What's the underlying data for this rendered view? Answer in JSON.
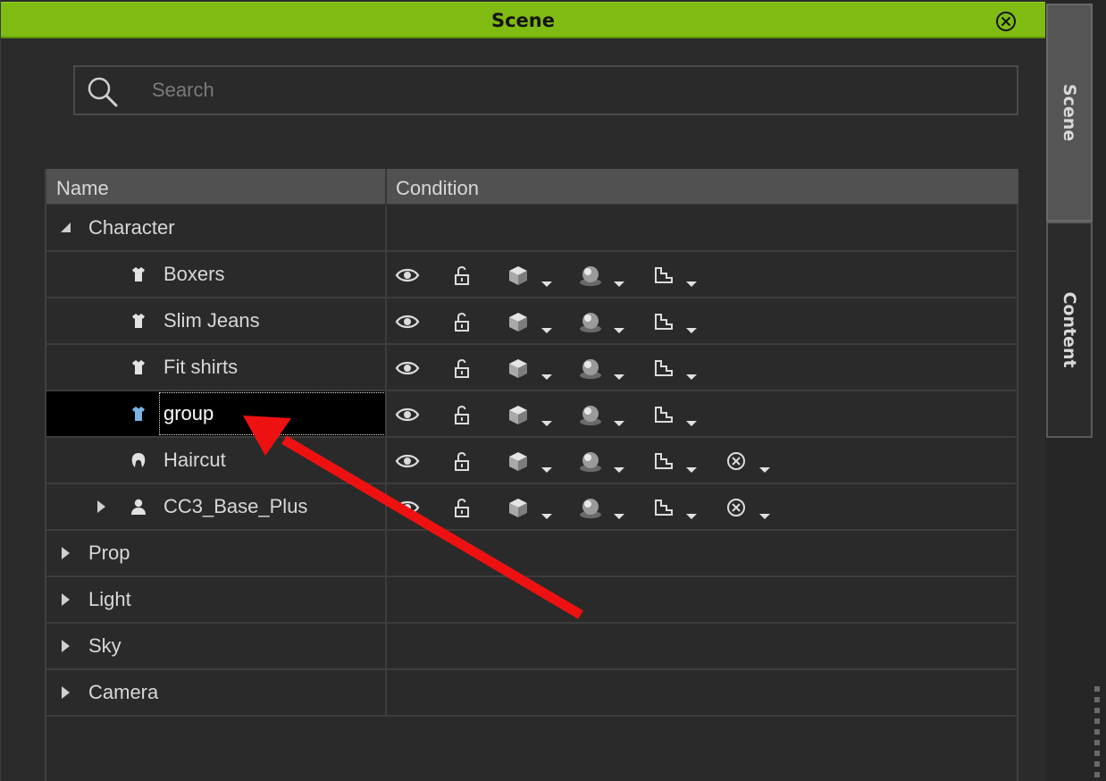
{
  "panel": {
    "title": "Scene",
    "close_icon": "close-circle-icon",
    "accent": "#7fbb12"
  },
  "search": {
    "placeholder": "Search",
    "value": "",
    "icon": "search-icon"
  },
  "table": {
    "columns": [
      "Name",
      "Condition"
    ],
    "rows": [
      {
        "label": "Character",
        "type": "category",
        "expanded": true,
        "icon": ""
      },
      {
        "label": "Boxers",
        "type": "cloth",
        "icon": "shirt-icon",
        "conditions": [
          "eye-icon",
          "unlock-icon",
          "cube-icon",
          "sphere-icon",
          "stair-icon"
        ]
      },
      {
        "label": "Slim Jeans",
        "type": "cloth",
        "icon": "shirt-icon",
        "conditions": [
          "eye-icon",
          "unlock-icon",
          "cube-icon",
          "sphere-icon",
          "stair-icon"
        ]
      },
      {
        "label": "Fit shirts",
        "type": "cloth",
        "icon": "shirt-icon",
        "conditions": [
          "eye-icon",
          "unlock-icon",
          "cube-icon",
          "sphere-icon",
          "stair-icon"
        ]
      },
      {
        "label": "group",
        "type": "cloth",
        "icon": "shirt-icon",
        "selected": true,
        "conditions": [
          "eye-icon",
          "unlock-icon",
          "cube-icon",
          "sphere-icon",
          "stair-icon"
        ]
      },
      {
        "label": "Haircut",
        "type": "hair",
        "icon": "hair-icon",
        "conditions": [
          "eye-icon",
          "unlock-icon",
          "cube-icon",
          "sphere-icon",
          "stair-icon",
          "cancel-circle-icon"
        ]
      },
      {
        "label": "CC3_Base_Plus",
        "type": "body",
        "icon": "person-icon",
        "expanded": false,
        "conditions": [
          "eye-icon",
          "unlock-icon",
          "cube-icon",
          "sphere-icon",
          "stair-icon",
          "cancel-circle-icon"
        ]
      },
      {
        "label": "Prop",
        "type": "category",
        "expanded": false
      },
      {
        "label": "Light",
        "type": "category",
        "expanded": false
      },
      {
        "label": "Sky",
        "type": "category",
        "expanded": false
      },
      {
        "label": "Camera",
        "type": "category",
        "expanded": false
      }
    ]
  },
  "side_tabs": [
    {
      "label": "Scene",
      "active": true
    },
    {
      "label": "Content",
      "active": false
    }
  ],
  "colors": {
    "selection": "#000000",
    "annotation_arrow": "#ee1111"
  }
}
